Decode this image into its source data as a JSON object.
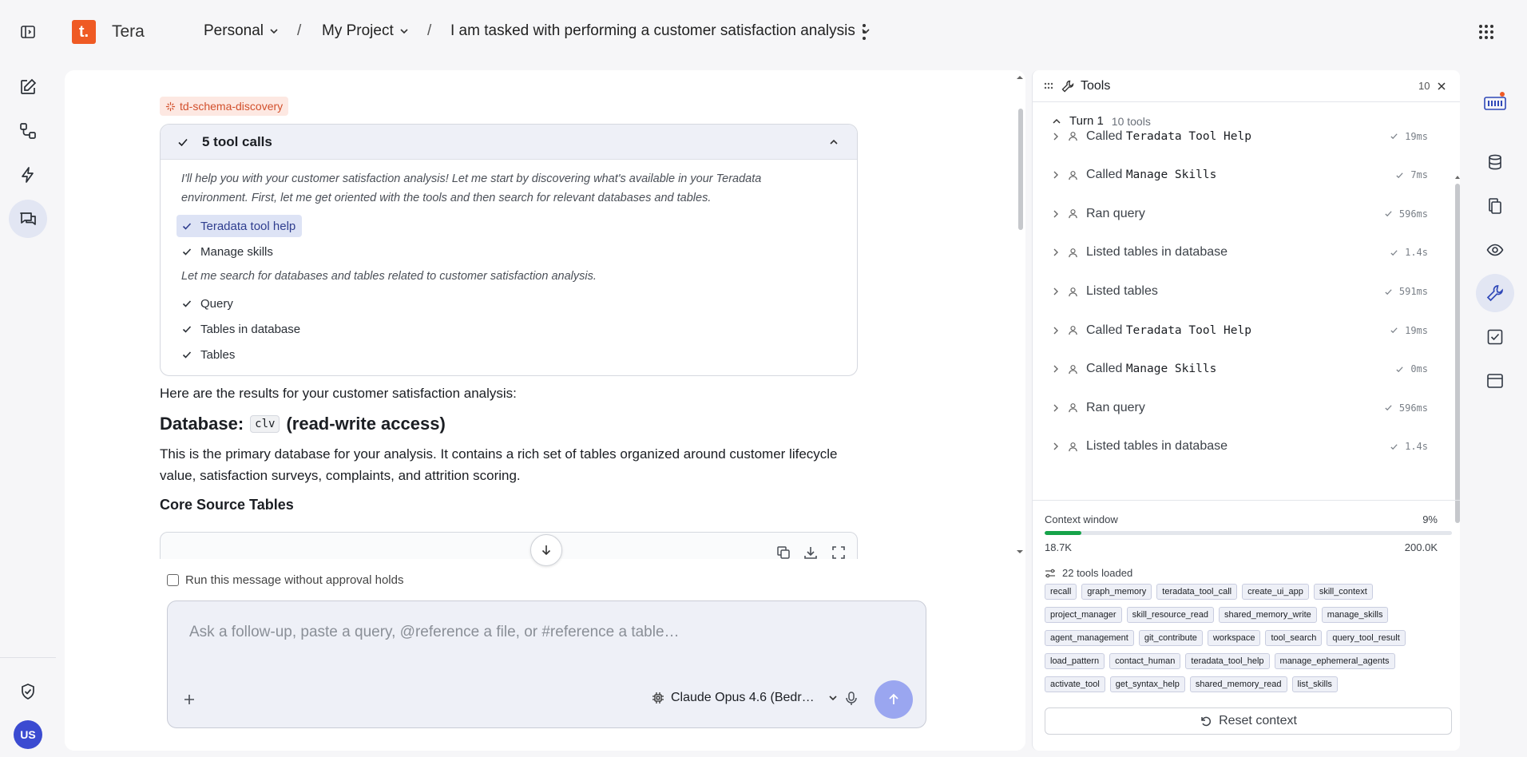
{
  "app": {
    "logo_letter": "t.",
    "name": "Tera"
  },
  "breadcrumb": {
    "workspace": "Personal",
    "project": "My Project",
    "chat": "I am tasked with performing a customer satisfaction analysis"
  },
  "user": {
    "initials": "US"
  },
  "chat": {
    "skill_tag": "td-schema-discovery",
    "tool_calls": {
      "title": "5 tool calls",
      "note1": "I'll help you with your customer satisfaction analysis! Let me start by discovering what's available in your Teradata environment. First, let me get oriented with the tools and then search for relevant databases and tables.",
      "items_a": [
        "Teradata tool help",
        "Manage skills"
      ],
      "note2": "Let me search for databases and tables related to customer satisfaction analysis.",
      "items_b": [
        "Query",
        "Tables in database",
        "Tables"
      ]
    },
    "results_intro": "Here are the results for your customer satisfaction analysis:",
    "db_heading_prefix": "Database:",
    "db_name": "clv",
    "db_heading_suffix": "(read-write access)",
    "db_description": "This is the primary database for your analysis. It contains a rich set of tables organized around customer lifecycle value, satisfaction surveys, complaints, and attrition scoring.",
    "section_title": "Core Source Tables",
    "approval_label": "Run this message without approval holds",
    "composer_placeholder": "Ask a follow-up, paste a query, @reference a file, or #reference a table…",
    "model_label": "Claude Opus 4.6 (Bedr…"
  },
  "tools_panel": {
    "title": "Tools",
    "count": "10",
    "turn_label": "Turn 1",
    "turn_sub": "10 tools",
    "rows": [
      {
        "prefix": "Called",
        "name": "Teradata Tool Help",
        "duration": "19ms"
      },
      {
        "prefix": "Called",
        "name": "Manage Skills",
        "duration": "7ms"
      },
      {
        "prefix": "Ran query",
        "name": "",
        "duration": "596ms"
      },
      {
        "prefix": "Listed tables in database",
        "name": "",
        "duration": "1.4s"
      },
      {
        "prefix": "Listed tables",
        "name": "",
        "duration": "591ms"
      },
      {
        "prefix": "Called",
        "name": "Teradata Tool Help",
        "duration": "19ms"
      },
      {
        "prefix": "Called",
        "name": "Manage Skills",
        "duration": "0ms"
      },
      {
        "prefix": "Ran query",
        "name": "",
        "duration": "596ms"
      },
      {
        "prefix": "Listed tables in database",
        "name": "",
        "duration": "1.4s"
      }
    ],
    "context": {
      "label": "Context window",
      "percent": "9%",
      "fraction": 0.09,
      "used": "18.7K",
      "total": "200.0K"
    },
    "loaded_label": "22 tools loaded",
    "chips": [
      "recall",
      "graph_memory",
      "teradata_tool_call",
      "create_ui_app",
      "skill_context",
      "project_manager",
      "skill_resource_read",
      "shared_memory_write",
      "manage_skills",
      "agent_management",
      "git_contribute",
      "workspace",
      "tool_search",
      "query_tool_result",
      "load_pattern",
      "contact_human",
      "teradata_tool_help",
      "manage_ephemeral_agents",
      "activate_tool",
      "get_syntax_help",
      "shared_memory_read",
      "list_skills"
    ],
    "reset_label": "Reset context"
  },
  "colors": {
    "accent": "#ef5a24",
    "primary": "#3b4bd1",
    "send": "#9aa6f0",
    "progress": "#16a34a"
  }
}
